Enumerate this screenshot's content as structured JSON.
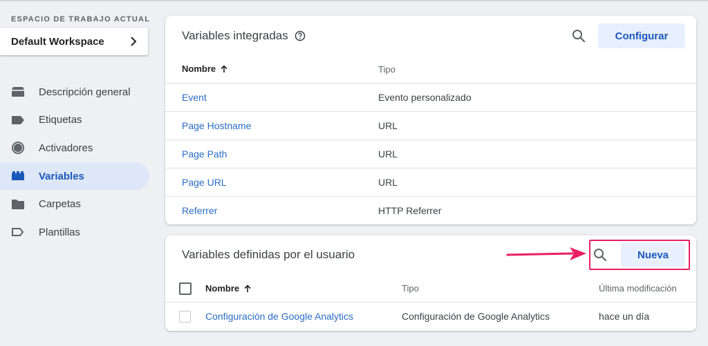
{
  "sidebar": {
    "workspace_caption": "ESPACIO DE TRABAJO ACTUAL",
    "workspace_name": "Default Workspace",
    "items": [
      {
        "label": "Descripción general",
        "icon": "overview-icon",
        "active": false
      },
      {
        "label": "Etiquetas",
        "icon": "tag-icon",
        "active": false
      },
      {
        "label": "Activadores",
        "icon": "trigger-icon",
        "active": false
      },
      {
        "label": "Variables",
        "icon": "variables-icon",
        "active": true
      },
      {
        "label": "Carpetas",
        "icon": "folder-icon",
        "active": false
      },
      {
        "label": "Plantillas",
        "icon": "template-icon",
        "active": false
      }
    ]
  },
  "builtin": {
    "title": "Variables integradas",
    "configure_label": "Configurar",
    "col_name": "Nombre",
    "col_type": "Tipo",
    "rows": [
      {
        "name": "Event",
        "type": "Evento personalizado"
      },
      {
        "name": "Page Hostname",
        "type": "URL"
      },
      {
        "name": "Page Path",
        "type": "URL"
      },
      {
        "name": "Page URL",
        "type": "URL"
      },
      {
        "name": "Referrer",
        "type": "HTTP Referrer"
      }
    ]
  },
  "user": {
    "title": "Variables definidas por el usuario",
    "new_label": "Nueva",
    "col_name": "Nombre",
    "col_type": "Tipo",
    "col_modified": "Última modificación",
    "rows": [
      {
        "name": "Configuración de Google Analytics",
        "type": "Configuración de Google Analytics",
        "modified": "hace un día"
      }
    ]
  },
  "colors": {
    "accent": "#1a57b8",
    "link": "#2a6cc4",
    "active_nav_bg": "#dde7f8",
    "highlight": "#e91e63"
  }
}
